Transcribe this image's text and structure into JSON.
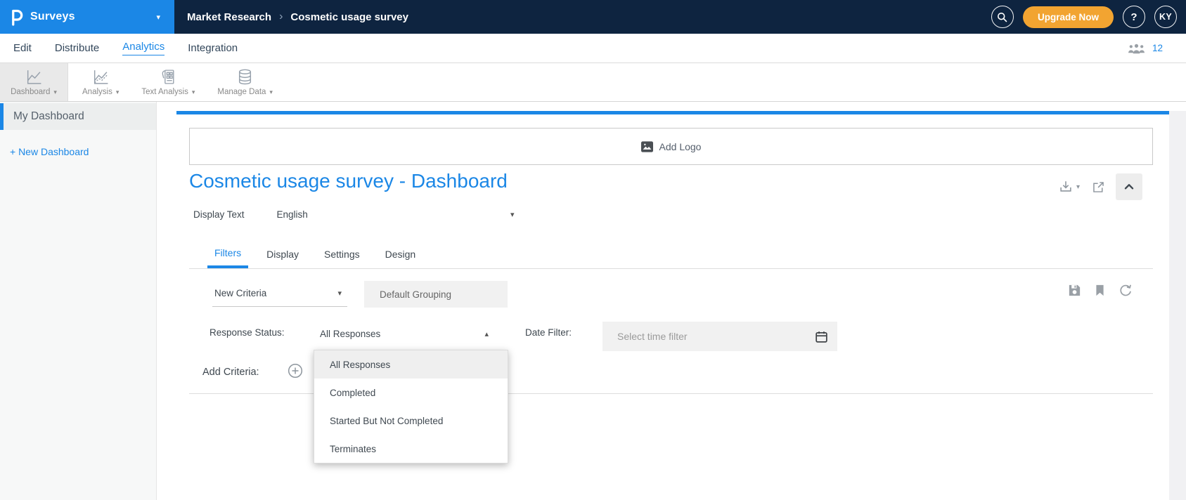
{
  "topbar": {
    "product": "Surveys",
    "breadcrumb": [
      "Market Research",
      "Cosmetic usage survey"
    ],
    "upgrade_label": "Upgrade Now",
    "help_label": "?",
    "avatar_initials": "KY"
  },
  "nav": {
    "items": [
      "Edit",
      "Distribute",
      "Analytics",
      "Integration"
    ],
    "active": "Analytics",
    "collaborators_count": "12"
  },
  "toolbar": {
    "items": [
      {
        "label": "Dashboard",
        "icon": "dashboard-chart-icon"
      },
      {
        "label": "Analysis",
        "icon": "analysis-chart-icon"
      },
      {
        "label": "Text Analysis",
        "icon": "text-analysis-icon"
      },
      {
        "label": "Manage Data",
        "icon": "database-icon"
      }
    ],
    "active": "Dashboard"
  },
  "sidebar": {
    "items": [
      {
        "label": "My Dashboard"
      }
    ],
    "new_dashboard_label": "+ New Dashboard"
  },
  "main": {
    "add_logo_label": "Add Logo",
    "title": "Cosmetic usage survey - Dashboard",
    "display_text": {
      "label": "Display Text",
      "value": "English"
    },
    "tabs": [
      "Filters",
      "Display",
      "Settings",
      "Design"
    ],
    "active_tab": "Filters",
    "filters": {
      "criteria_value": "New Criteria",
      "grouping_value": "Default Grouping",
      "response_status_label": "Response Status:",
      "response_status_value": "All Responses",
      "response_status_options": [
        "All Responses",
        "Completed",
        "Started But Not Completed",
        "Terminates"
      ],
      "selected_option": "All Responses",
      "date_filter_label": "Date Filter:",
      "date_filter_placeholder": "Select time filter",
      "add_criteria_label": "Add Criteria:"
    }
  },
  "icons": {
    "chevron_down": "▾",
    "chevron_up": "▴",
    "breadcrumb_separator": "›"
  },
  "colors": {
    "accent": "#1b87e6",
    "navy": "#0e2440",
    "upgrade": "#f2a431"
  }
}
